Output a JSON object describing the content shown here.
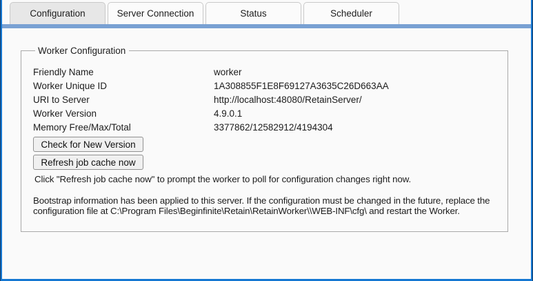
{
  "tabs": [
    {
      "label": "Configuration",
      "active": true
    },
    {
      "label": "Server Connection",
      "active": false
    },
    {
      "label": "Status",
      "active": false
    },
    {
      "label": "Scheduler",
      "active": false
    }
  ],
  "panel": {
    "legend": "Worker Configuration",
    "fields": [
      {
        "label": "Friendly Name",
        "value": "worker"
      },
      {
        "label": "Worker Unique ID",
        "value": "1A308855F1E8F69127A3635C26D663AA"
      },
      {
        "label": "URI to Server",
        "value": "http://localhost:48080/RetainServer/"
      },
      {
        "label": "Worker Version",
        "value": "4.9.0.1"
      },
      {
        "label": "Memory Free/Max/Total",
        "value": "3377862/12582912/4194304"
      }
    ],
    "buttons": {
      "check_version": "Check for New Version",
      "refresh_cache": "Refresh job cache now"
    },
    "note": "Click \"Refresh job cache now\" to prompt the worker to poll for configuration changes right now.",
    "bootstrap_message": "Bootstrap information has been applied to this server. If the configuration must be changed in the future, replace the configuration file at C:\\Program Files\\Beginfinite\\Retain\\RetainWorker\\\\WEB-INF\\cfg\\ and restart the Worker."
  },
  "colors": {
    "frame_blue": "#1477d2",
    "frame_dark": "#123a66",
    "tab_underline_blue": "#79a1d3",
    "active_tab_bg": "#e7e7e7",
    "inactive_tab_bg": "#fbfbfb",
    "tab_border": "#c9c9c9",
    "window_bg": "#fafafa",
    "fieldset_border": "#a9a9a9",
    "text": "#1c1c1c"
  }
}
